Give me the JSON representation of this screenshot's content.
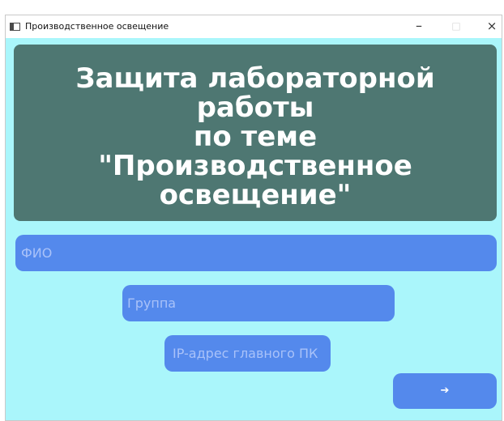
{
  "window": {
    "title": "Производственное освещение",
    "controls": {
      "minimize": "–",
      "maximize": "□",
      "close": "×"
    }
  },
  "header": {
    "title": "Защита лабораторной работы\nпо теме\n\"Производственное\nосвещение\""
  },
  "form": {
    "fio_placeholder": "ФИО",
    "group_placeholder": "Группа",
    "ip_placeholder": "IP-адрес главного ПК",
    "next_label": "➔"
  },
  "colors": {
    "background": "#aaf6fb",
    "title_panel": "#4e7772",
    "field": "#5489ec",
    "placeholder": "#a9c2f9",
    "title_text": "#ffffff"
  },
  "icons": {
    "app": "window-app-icon",
    "next": "arrow-right-icon"
  }
}
